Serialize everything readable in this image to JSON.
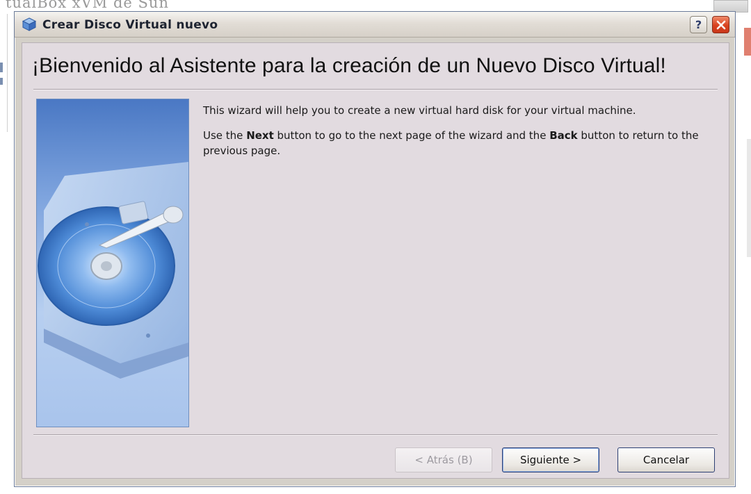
{
  "background_window": {
    "title_fragment": "tualBox xVM de Sun"
  },
  "dialog": {
    "title": "Crear Disco Virtual nuevo",
    "help_label": "?",
    "heading": "¡Bienvenido al  Asistente para la creación de un Nuevo Disco Virtual!",
    "paragraph1": "This wizard will help you to create a new virtual hard disk for your virtual machine.",
    "paragraph2": {
      "part1": "Use the ",
      "bold1": "Next",
      "part2": " button to go to the next page of the wizard and the ",
      "bold2": "Back",
      "part3": " button to return to the previous page."
    },
    "buttons": {
      "back": "< Atrás (B)",
      "next": "Siguiente >",
      "cancel": "Cancelar"
    }
  },
  "icons": {
    "title_icon": "virtualbox-cube-icon",
    "side_image": "hard-disk-illustration"
  },
  "colors": {
    "title_text": "#1d2330",
    "close_button": "#d9421f",
    "content_bg": "#e2dbe0",
    "side_panel": "#7ea4de"
  }
}
